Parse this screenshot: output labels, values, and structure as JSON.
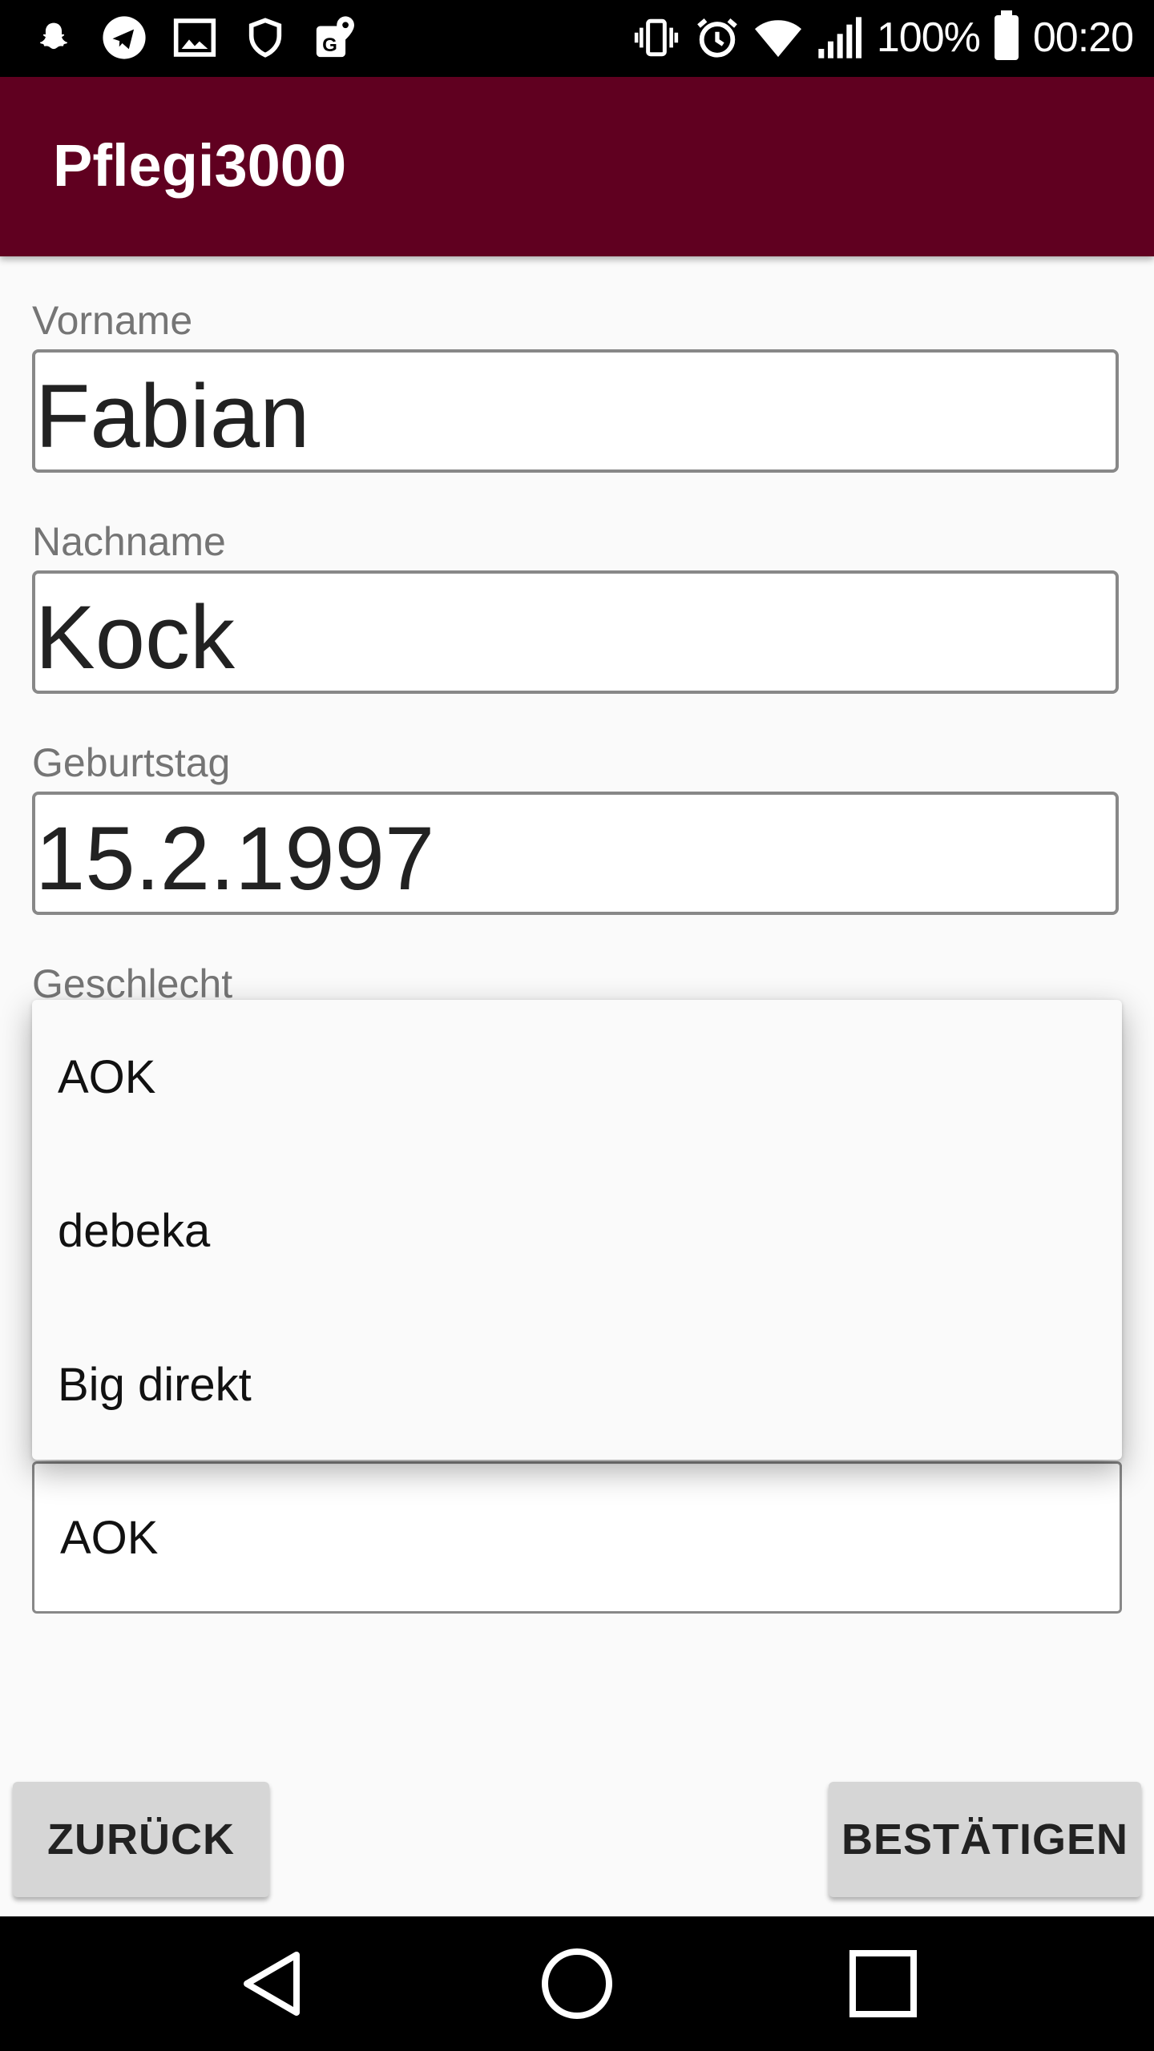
{
  "status_bar": {
    "left_icons": [
      "snapchat-icon",
      "telegram-icon",
      "gallery-icon",
      "shield-icon",
      "maps-icon"
    ],
    "right_icons": [
      "vibrate-icon",
      "alarm-icon",
      "wifi-icon",
      "cell-signal-icon",
      "battery-icon"
    ],
    "battery": "100%",
    "time": "00:20"
  },
  "app_bar": {
    "title": "Pflegi3000",
    "color": "#600020"
  },
  "form": {
    "vorname": {
      "label": "Vorname",
      "value": "Fabian"
    },
    "nachname": {
      "label": "Nachname",
      "value": "Kock"
    },
    "geburtstag": {
      "label": "Geburtstag",
      "value": "15.2.1997"
    },
    "geschlecht": {
      "label": "Geschlecht"
    },
    "insurance_select": {
      "selected": "AOK",
      "options": [
        "AOK",
        "debeka",
        "Big direkt"
      ]
    }
  },
  "buttons": {
    "back": "ZURÜCK",
    "confirm": "BESTÄTIGEN"
  },
  "nav_bar": {
    "icons": [
      "back-icon",
      "home-icon",
      "recents-icon"
    ]
  }
}
